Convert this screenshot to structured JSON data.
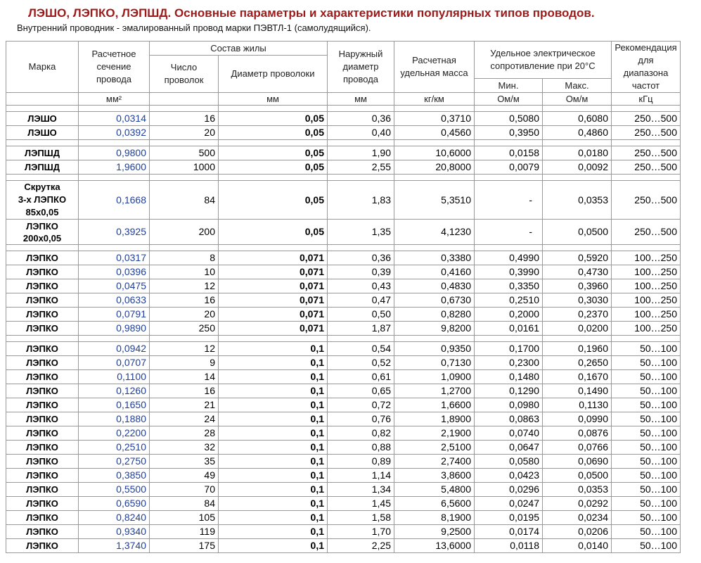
{
  "title": "ЛЭШО, ЛЭПКО, ЛЭПШД. Основные параметры и характеристики популярных типов проводов.",
  "subtitle": "Внутренний проводник - эмалированный провод марки ПЭВТЛ-1 (самолудящийся).",
  "headers": {
    "mark": "Марка",
    "section": "Расчетное сечение провода",
    "composition": "Состав жилы",
    "wire_count": "Число проволок",
    "wire_diameter": "Диаметр проволоки",
    "outer_diameter": "Наружный диаметр провода",
    "mass": "Расчетная удельная масса",
    "resistance": "Удельное электрическое сопротивление при 20°С",
    "res_min": "Мин.",
    "res_max": "Макс.",
    "freq": "Рекомендация для диапазона частот"
  },
  "units": {
    "section": "мм²",
    "wire_diameter": "мм",
    "outer_diameter": "мм",
    "mass": "кг/км",
    "res_min": "Ом/м",
    "res_max": "Ом/м",
    "freq": "кГц"
  },
  "groups": [
    [
      [
        "ЛЭШО",
        "0,0314",
        "16",
        "0,05",
        "0,36",
        "0,3710",
        "0,5080",
        "0,6080",
        "250…500"
      ],
      [
        "ЛЭШО",
        "0,0392",
        "20",
        "0,05",
        "0,40",
        "0,4560",
        "0,3950",
        "0,4860",
        "250…500"
      ]
    ],
    [
      [
        "ЛЭПШД",
        "0,9800",
        "500",
        "0,05",
        "1,90",
        "10,6000",
        "0,0158",
        "0,0180",
        "250…500"
      ],
      [
        "ЛЭПШД",
        "1,9600",
        "1000",
        "0,05",
        "2,55",
        "20,8000",
        "0,0079",
        "0,0092",
        "250…500"
      ]
    ],
    [
      [
        "Скрутка\n3-х ЛЭПКО\n85х0,05",
        "0,1668",
        "84",
        "0,05",
        "1,83",
        "5,3510",
        "-",
        "0,0353",
        "250…500"
      ],
      [
        "ЛЭПКО\n200х0,05",
        "0,3925",
        "200",
        "0,05",
        "1,35",
        "4,1230",
        "-",
        "0,0500",
        "250…500"
      ]
    ],
    [
      [
        "ЛЭПКО",
        "0,0317",
        "8",
        "0,071",
        "0,36",
        "0,3380",
        "0,4990",
        "0,5920",
        "100…250"
      ],
      [
        "ЛЭПКО",
        "0,0396",
        "10",
        "0,071",
        "0,39",
        "0,4160",
        "0,3990",
        "0,4730",
        "100…250"
      ],
      [
        "ЛЭПКО",
        "0,0475",
        "12",
        "0,071",
        "0,43",
        "0,4830",
        "0,3350",
        "0,3960",
        "100…250"
      ],
      [
        "ЛЭПКО",
        "0,0633",
        "16",
        "0,071",
        "0,47",
        "0,6730",
        "0,2510",
        "0,3030",
        "100…250"
      ],
      [
        "ЛЭПКО",
        "0,0791",
        "20",
        "0,071",
        "0,50",
        "0,8280",
        "0,2000",
        "0,2370",
        "100…250"
      ],
      [
        "ЛЭПКО",
        "0,9890",
        "250",
        "0,071",
        "1,87",
        "9,8200",
        "0,0161",
        "0,0200",
        "100…250"
      ]
    ],
    [
      [
        "ЛЭПКО",
        "0,0942",
        "12",
        "0,1",
        "0,54",
        "0,9350",
        "0,1700",
        "0,1960",
        "50…100"
      ],
      [
        "ЛЭПКО",
        "0,0707",
        "9",
        "0,1",
        "0,52",
        "0,7130",
        "0,2300",
        "0,2650",
        "50…100"
      ],
      [
        "ЛЭПКО",
        "0,1100",
        "14",
        "0,1",
        "0,61",
        "1,0900",
        "0,1480",
        "0,1670",
        "50…100"
      ],
      [
        "ЛЭПКО",
        "0,1260",
        "16",
        "0,1",
        "0,65",
        "1,2700",
        "0,1290",
        "0,1490",
        "50…100"
      ],
      [
        "ЛЭПКО",
        "0,1650",
        "21",
        "0,1",
        "0,72",
        "1,6600",
        "0,0980",
        "0,1130",
        "50…100"
      ],
      [
        "ЛЭПКО",
        "0,1880",
        "24",
        "0,1",
        "0,76",
        "1,8900",
        "0,0863",
        "0,0990",
        "50…100"
      ],
      [
        "ЛЭПКО",
        "0,2200",
        "28",
        "0,1",
        "0,82",
        "2,1900",
        "0,0740",
        "0,0876",
        "50…100"
      ],
      [
        "ЛЭПКО",
        "0,2510",
        "32",
        "0,1",
        "0,88",
        "2,5100",
        "0,0647",
        "0,0766",
        "50…100"
      ],
      [
        "ЛЭПКО",
        "0,2750",
        "35",
        "0,1",
        "0,89",
        "2,7400",
        "0,0580",
        "0,0690",
        "50…100"
      ],
      [
        "ЛЭПКО",
        "0,3850",
        "49",
        "0,1",
        "1,14",
        "3,8600",
        "0,0423",
        "0,0500",
        "50…100"
      ],
      [
        "ЛЭПКО",
        "0,5500",
        "70",
        "0,1",
        "1,34",
        "5,4800",
        "0,0296",
        "0,0353",
        "50…100"
      ],
      [
        "ЛЭПКО",
        "0,6590",
        "84",
        "0,1",
        "1,45",
        "6,5600",
        "0,0247",
        "0,0292",
        "50…100"
      ],
      [
        "ЛЭПКО",
        "0,8240",
        "105",
        "0,1",
        "1,58",
        "8,1900",
        "0,0195",
        "0,0234",
        "50…100"
      ],
      [
        "ЛЭПКО",
        "0,9340",
        "119",
        "0,1",
        "1,70",
        "9,2500",
        "0,0174",
        "0,0206",
        "50…100"
      ],
      [
        "ЛЭПКО",
        "1,3740",
        "175",
        "0,1",
        "2,25",
        "13,6000",
        "0,0118",
        "0,0140",
        "50…100"
      ]
    ]
  ]
}
